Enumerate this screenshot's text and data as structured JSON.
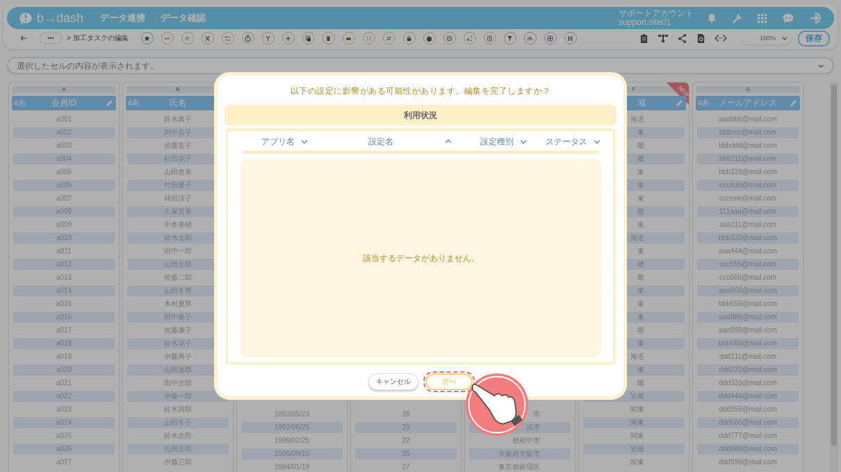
{
  "header": {
    "logo": "b→dash",
    "nav": [
      {
        "label": "データ連携"
      },
      {
        "label": "データ確認"
      }
    ],
    "account": {
      "name": "サポートアカウント",
      "id": "support.site01"
    }
  },
  "toolbar": {
    "more": "•••",
    "breadcrumb": "> 加工タスクの編集",
    "zoom": "100%",
    "save": "保存"
  },
  "formula_bar": {
    "placeholder": "選択したセルの内容が表示されます。"
  },
  "columns": [
    {
      "letter": "A",
      "header": "会員ID",
      "type_label": "aあ",
      "editable": true,
      "cells": [
        "a001",
        "a002",
        "a003",
        "a004",
        "a005",
        "a006",
        "a007",
        "a008",
        "a009",
        "a010",
        "a011",
        "a012",
        "a013",
        "a014",
        "a015",
        "a016",
        "a017",
        "a018",
        "a019",
        "a020",
        "a021",
        "a022",
        "a023",
        "a024",
        "a025",
        "a026",
        "a027"
      ]
    },
    {
      "letter": "B",
      "header": "氏名",
      "type_label": "aあ",
      "editable": false,
      "cells": [
        "鈴木典子",
        "田中京子",
        "佐藤直子",
        "杉田花子",
        "山田恵美",
        "竹田愛子",
        "林田涼子",
        "久保直美",
        "中本美樹",
        "鈴木太郎",
        "田中一郎",
        "山田五郎",
        "佐藤二郎",
        "山田冬男",
        "木村夏男",
        "田中春子",
        "佐藤康子",
        "鈴木花子",
        "伊藤典子",
        "山田達郎",
        "田中次郎",
        "伊藤一郎",
        "鈴木四郎",
        "山田冬子",
        "鈴木次郎",
        "吉田五郎",
        "伊藤三郎"
      ]
    },
    {
      "cells": [
        "1993/05/23",
        "1992/06/25",
        "1999/02/25",
        "1996/09/15",
        "1994/01/19"
      ]
    },
    {
      "cells": [
        "28",
        "29",
        "22",
        "25",
        "27"
      ]
    },
    {
      "cells": [
        "市",
        "浜市",
        "都府中市",
        "大阪府大阪市",
        "東京都新宿区"
      ]
    },
    {
      "letter": "F",
      "header": "域",
      "editable": true,
      "ribbon": "NEW",
      "cells": [
        "海道",
        "東",
        "畿",
        "畿",
        "東",
        "東",
        "東",
        "畿",
        "東",
        "海道",
        "東",
        "畿",
        "畿",
        "東",
        "東",
        "東",
        "畿",
        "東",
        "海道",
        "東",
        "畿",
        "近畿",
        "関東",
        "関東",
        "関東",
        "近畿",
        "関東"
      ]
    },
    {
      "letter": "G",
      "header": "メールアドレス",
      "type_label": "aあ",
      "editable": true,
      "cells": [
        "aaabbb@mail.com",
        "bbbccc@mail.com",
        "bbbddd@mail.com",
        "bbb111@mail.com",
        "bbb333@mail.com",
        "cccddd@mail.com",
        "ccceee@mail.com",
        "111aaa@mail.com",
        "aaa111@mail.com",
        "bbb333@mail.com",
        "aaa444@mail.com",
        "ccc555@mail.com",
        "ccc666@mail.com",
        "aaa666@mail.com",
        "bbb555@mail.com",
        "aaa888@mail.com",
        "aaa999@mail.com",
        "bbb666@mail.com",
        "ddd111@mail.com",
        "ddd222@mail.com",
        "ddd333@mail.com",
        "ddd444@mail.com",
        "ddd555@mail.com",
        "ddd666@mail.com",
        "ddd777@mail.com",
        "ddd888@mail.com",
        "ddd999@mail.com"
      ]
    }
  ],
  "modal": {
    "title": "以下の設定に影響がある可能性があります。編集を完了しますか？",
    "section": "利用状況",
    "table_columns": [
      {
        "label": "アプリ名",
        "ascending": false
      },
      {
        "label": "設定名",
        "ascending": true
      },
      {
        "label": "設定種別",
        "ascending": false
      },
      {
        "label": "ステータス",
        "ascending": false
      }
    ],
    "empty_message": "該当するデータがありません。",
    "buttons": [
      {
        "label": "キャンセル",
        "kind": "secondary",
        "highlighted": false
      },
      {
        "label": "次へ",
        "kind": "primary",
        "highlighted": true
      }
    ]
  }
}
